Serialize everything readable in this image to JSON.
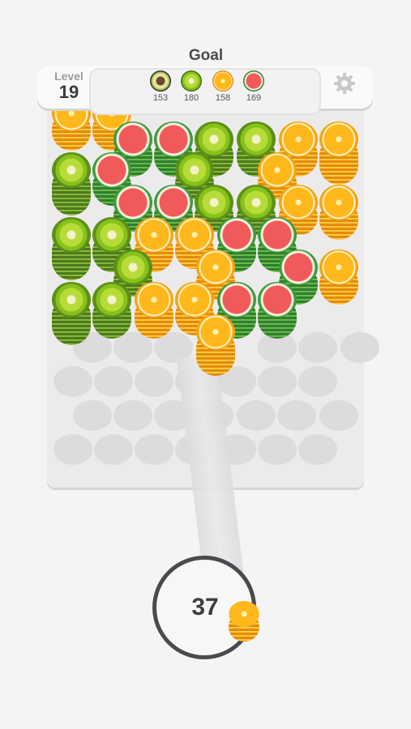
{
  "header": {
    "level_label": "Level",
    "level_number": "19",
    "goal_title": "Goal",
    "goals": [
      {
        "icon": "avocado-icon",
        "count": "153"
      },
      {
        "icon": "kiwi-icon",
        "count": "180"
      },
      {
        "icon": "orange-icon",
        "count": "158"
      },
      {
        "icon": "watermelon-icon",
        "count": "169"
      }
    ]
  },
  "shooter": {
    "remaining": "37"
  },
  "colors": {
    "kiwi": "#8ec03a",
    "watermelon": "#f05a5a",
    "orange": "#ffb81c",
    "avocado": "#3b3b2a"
  }
}
